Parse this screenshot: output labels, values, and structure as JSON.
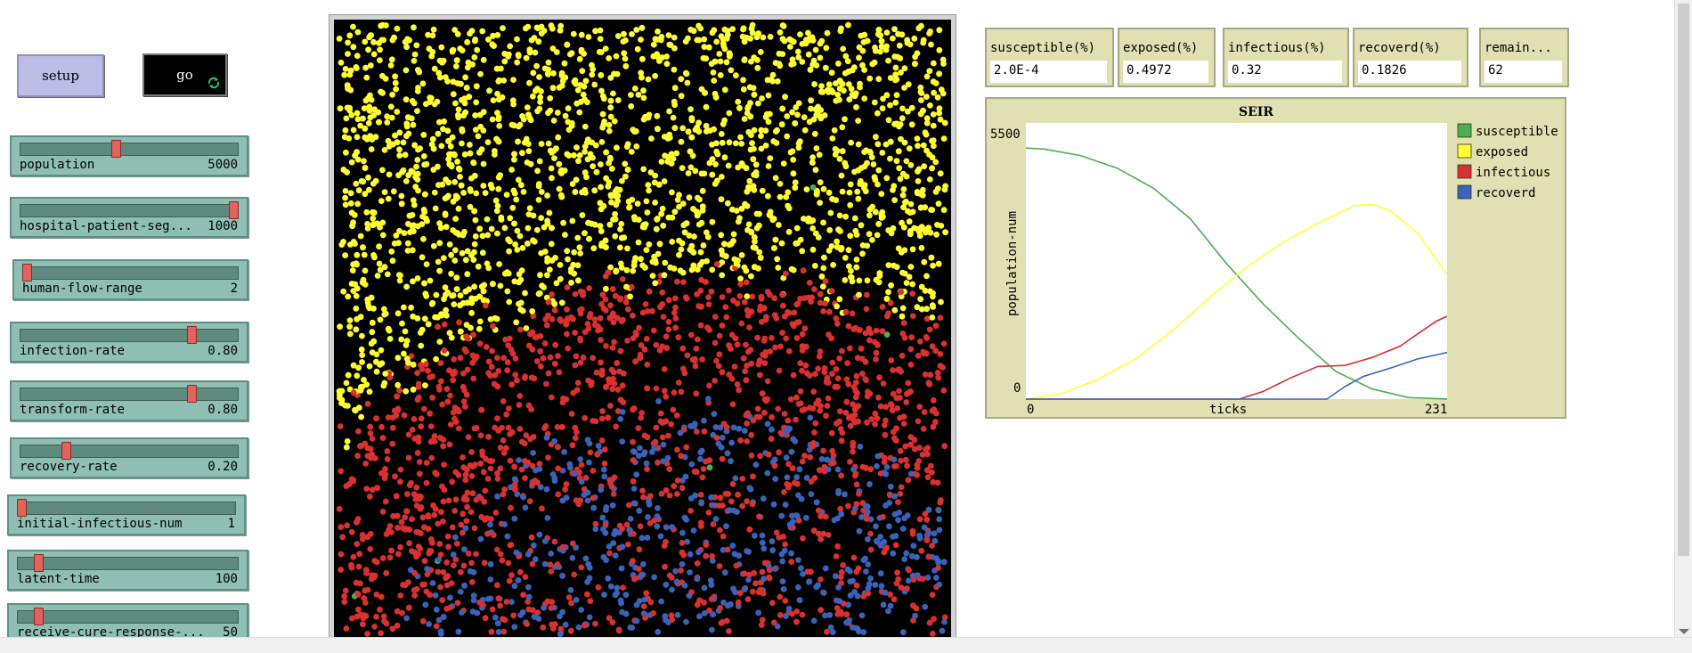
{
  "buttons": {
    "setup_label": "setup",
    "go_label": "go"
  },
  "sliders": [
    {
      "label": "population",
      "value": "5000",
      "fraction": 0.44
    },
    {
      "label": "hospital-patient-seg...",
      "value": "1000",
      "fraction": 1.0
    },
    {
      "label": "human-flow-range",
      "value": "2",
      "fraction": 0.0
    },
    {
      "label": "infection-rate",
      "value": "0.80",
      "fraction": 0.8
    },
    {
      "label": "transform-rate",
      "value": "0.80",
      "fraction": 0.8
    },
    {
      "label": "recovery-rate",
      "value": "0.20",
      "fraction": 0.2
    },
    {
      "label": "initial-infectious-num",
      "value": "1",
      "fraction": 0.0
    },
    {
      "label": "latent-time",
      "value": "100",
      "fraction": 0.08
    },
    {
      "label": "receive-cure-response-...",
      "value": "50",
      "fraction": 0.08
    }
  ],
  "monitors": [
    {
      "label": "susceptible(%)",
      "value": "2.0E-4"
    },
    {
      "label": "exposed(%)",
      "value": "0.4972"
    },
    {
      "label": "infectious(%)",
      "value": "0.32"
    },
    {
      "label": "recoverd(%)",
      "value": "0.1826"
    },
    {
      "label": "remain...",
      "value": "62"
    }
  ],
  "colors": {
    "susceptible": "#4caf50",
    "exposed": "#ffff33",
    "infectious": "#d93030",
    "recoverd": "#3a62b8"
  },
  "world": {
    "population_shown": 5000
  },
  "chart_data": {
    "type": "line",
    "title": "SEIR",
    "xlabel": "ticks",
    "ylabel": "population-num",
    "xlim": [
      0,
      231
    ],
    "ylim": [
      0,
      5500
    ],
    "x_tick_labels": [
      "0",
      "231"
    ],
    "y_tick_labels": [
      "0",
      "5500"
    ],
    "legend_position": "right",
    "series": [
      {
        "name": "susceptible",
        "color": "#4caf50",
        "x": [
          0,
          10,
          30,
          50,
          70,
          90,
          110,
          130,
          150,
          170,
          190,
          210,
          231
        ],
        "y": [
          5000,
          4980,
          4850,
          4600,
          4200,
          3600,
          2700,
          1900,
          1200,
          550,
          200,
          30,
          1
        ]
      },
      {
        "name": "exposed",
        "color": "#ffff33",
        "x": [
          0,
          20,
          40,
          60,
          80,
          100,
          120,
          140,
          160,
          180,
          190,
          200,
          215,
          231
        ],
        "y": [
          0,
          120,
          400,
          800,
          1350,
          2000,
          2600,
          3100,
          3500,
          3850,
          3880,
          3750,
          3300,
          2480
        ]
      },
      {
        "name": "infectious",
        "color": "#d93030",
        "x": [
          0,
          117,
          130,
          145,
          160,
          175,
          190,
          205,
          215,
          225,
          231
        ],
        "y": [
          0,
          0,
          150,
          420,
          650,
          670,
          830,
          1050,
          1300,
          1550,
          1650
        ]
      },
      {
        "name": "recoverd",
        "color": "#3a62b8",
        "x": [
          0,
          165,
          175,
          185,
          200,
          215,
          231
        ],
        "y": [
          0,
          0,
          250,
          450,
          620,
          800,
          930
        ]
      }
    ]
  }
}
